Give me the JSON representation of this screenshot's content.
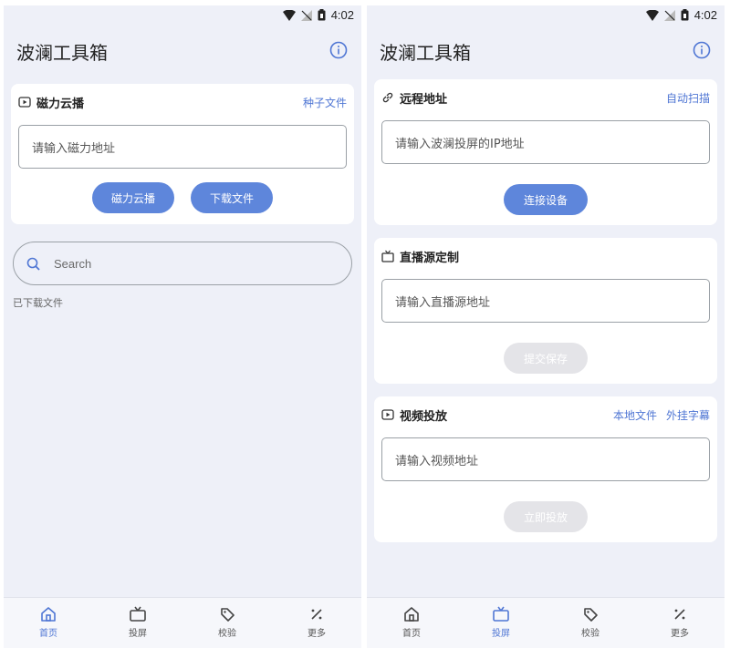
{
  "status": {
    "time": "4:02"
  },
  "app": {
    "title": "波澜工具箱"
  },
  "left": {
    "magnet_card": {
      "title": "磁力云播",
      "link": "种子文件",
      "input_placeholder": "请输入磁力地址",
      "play_button": "磁力云播",
      "download_button": "下载文件"
    },
    "search": {
      "placeholder": "Search"
    },
    "downloaded_label": "已下载文件"
  },
  "right": {
    "remote_card": {
      "title": "远程地址",
      "link": "自动扫描",
      "input_placeholder": "请输入波澜投屏的IP地址",
      "button": "连接设备"
    },
    "live_card": {
      "title": "直播源定制",
      "input_placeholder": "请输入直播源地址",
      "button": "提交保存"
    },
    "video_card": {
      "title": "视频投放",
      "link_local": "本地文件",
      "link_subtitle": "外挂字幕",
      "input_placeholder": "请输入视频地址",
      "button": "立即投放"
    }
  },
  "nav": {
    "items": [
      {
        "label": "首页",
        "icon": "home-icon"
      },
      {
        "label": "投屏",
        "icon": "tv-icon"
      },
      {
        "label": "校验",
        "icon": "tag-icon"
      },
      {
        "label": "更多",
        "icon": "percent-icon"
      }
    ],
    "left_active": "首页",
    "right_active": "投屏"
  },
  "colors": {
    "accent": "#5e86db",
    "link": "#4f76d4",
    "background": "#eef0f8",
    "card": "#ffffff",
    "disabled": "#e4e4e8"
  }
}
